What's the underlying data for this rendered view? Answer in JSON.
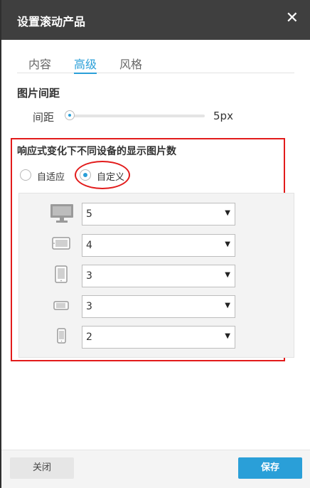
{
  "dialog": {
    "title": "设置滚动产品",
    "close_glyph": "✕"
  },
  "tabs": [
    {
      "label": "内容",
      "active": false
    },
    {
      "label": "高级",
      "active": true
    },
    {
      "label": "风格",
      "active": false
    }
  ],
  "image_spacing": {
    "section_title": "图片间距",
    "label": "间距",
    "value": "5px"
  },
  "responsive": {
    "section_title": "响应式变化下不同设备的显示图片数",
    "options": [
      {
        "label": "自适应",
        "checked": false
      },
      {
        "label": "自定义",
        "checked": true
      }
    ],
    "devices": [
      {
        "icon": "desktop-icon",
        "value": "5"
      },
      {
        "icon": "tablet-landscape-icon",
        "value": "4"
      },
      {
        "icon": "tablet-portrait-icon",
        "value": "3"
      },
      {
        "icon": "phone-landscape-icon",
        "value": "3"
      },
      {
        "icon": "phone-portrait-icon",
        "value": "2"
      }
    ]
  },
  "footer": {
    "close_label": "关闭",
    "save_label": "保存"
  },
  "colors": {
    "accent": "#2a9fd8",
    "header": "#3f3f3f",
    "highlight": "#e21b1b"
  }
}
